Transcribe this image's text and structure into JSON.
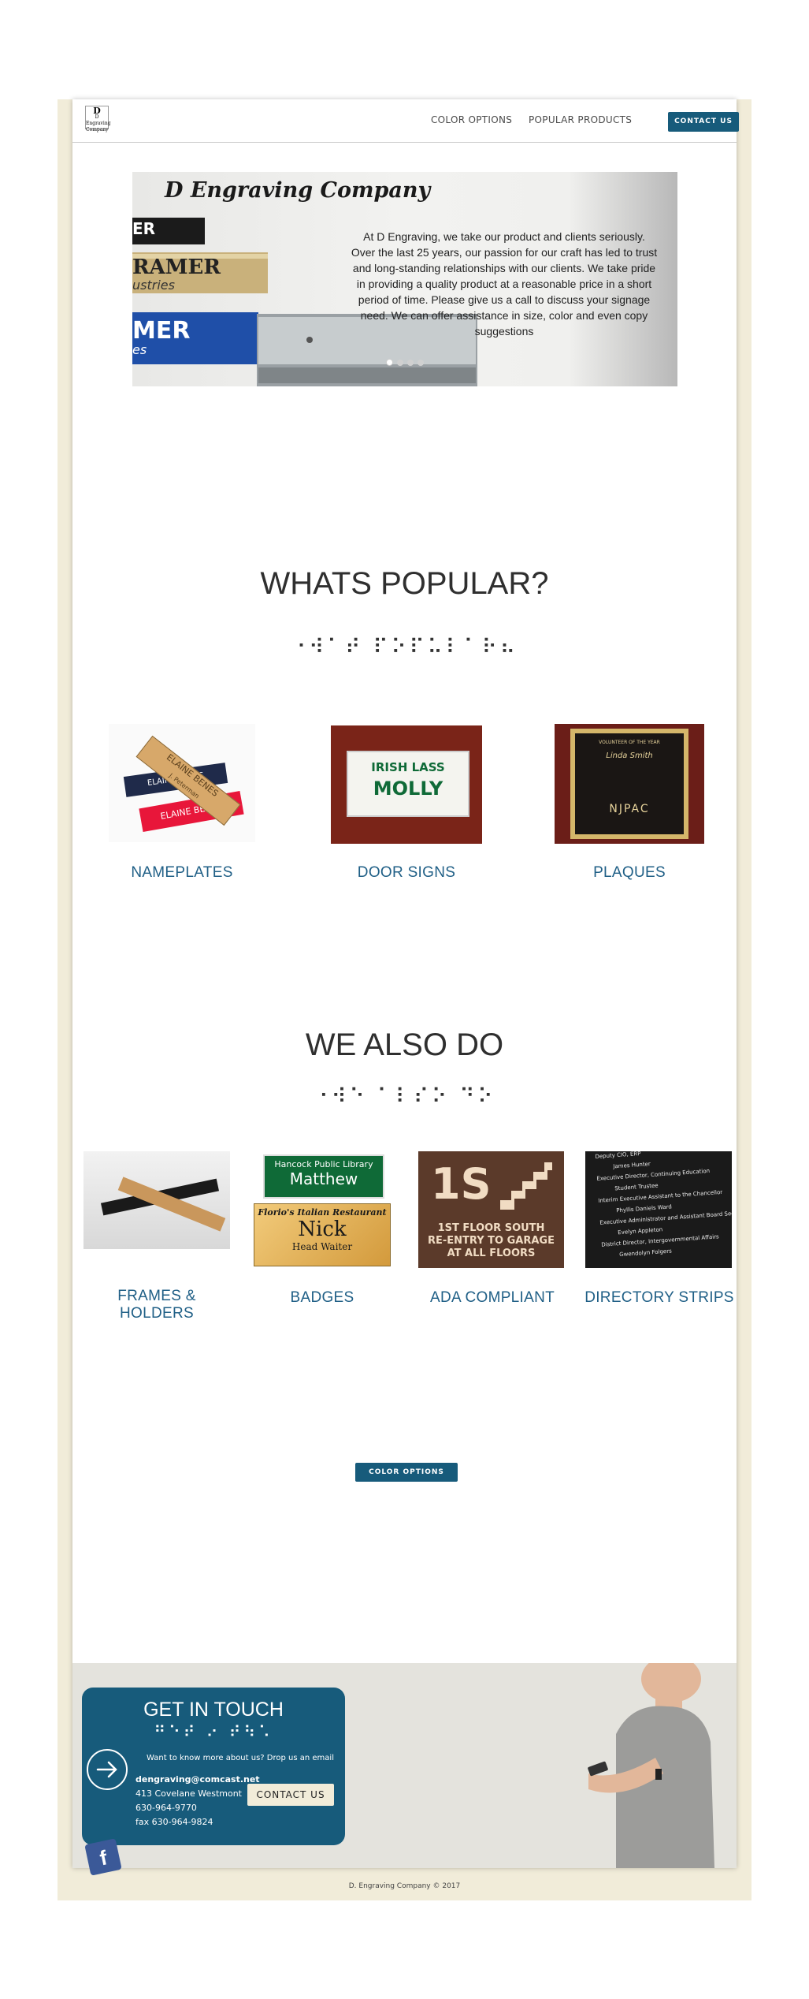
{
  "header": {
    "logo_text": "D Engraving Company",
    "nav": [
      "COLOR OPTIONS",
      "POPULAR PRODUCTS"
    ],
    "contact_button": "CONTACT US"
  },
  "hero": {
    "title": "D Engraving Company",
    "text": "At D Engraving, we take our product and clients seriously. Over the last 25 years, our passion for our craft has led to trust and long-standing relationships with our clients. We take pride in providing a quality product at a reasonable price in a short period of time. Please give us a call to discuss your signage need. We can offer assistance in size, color and even copy suggestions",
    "plates": [
      "ER",
      "RAMER",
      "MER"
    ],
    "plate_sub": [
      "ustries",
      "es"
    ]
  },
  "popular": {
    "heading": "WHATS POPULAR?",
    "braille": "⠐⠺⠁⠞ ⠏⠕⠏⠥⠇⠁⠗⠦",
    "items": [
      {
        "caption": "NAMEPLATES",
        "img_text": [
          "ELAINE BENES",
          "J. Peterman",
          "ELAINE BENES"
        ]
      },
      {
        "caption": "DOOR SIGNS",
        "img_text": [
          "IRISH LASS",
          "MOLLY"
        ]
      },
      {
        "caption": "PLAQUES",
        "img_text": [
          "VOLUNTEER OF THE YEAR",
          "Linda Smith",
          "NJPAC"
        ]
      }
    ]
  },
  "also": {
    "heading": "WE ALSO DO",
    "braille": "⠐⠺⠑ ⠁⠇⠎⠕ ⠙⠕",
    "items": [
      {
        "caption": "FRAMES & HOLDERS"
      },
      {
        "caption": "BADGES",
        "img_text": [
          "Hancock Public Library",
          "Matthew",
          "Florio's Italian Restaurant",
          "Nick",
          "Head Waiter"
        ]
      },
      {
        "caption": "ADA COMPLIANT",
        "img_text": [
          "1S",
          "1ST FLOOR SOUTH",
          "RE-ENTRY TO GARAGE",
          "AT ALL FLOORS"
        ]
      },
      {
        "caption": "DIRECTORY STRIPS",
        "img_text": [
          "Deputy CIO, ERP",
          "James Hunter",
          "Executive Director, Continuing Education",
          "Student Trustee",
          "Interim Executive Assistant to the Chancellor",
          "Phyllis Daniels Ward",
          "Executive Administrator and Assistant Board Secretary",
          "Evelyn Appleton",
          "District Director, Intergovernmental Affairs",
          "Gwendolyn Folgers"
        ]
      }
    ]
  },
  "color_options_button": "COLOR OPTIONS",
  "contact": {
    "title": "GET IN TOUCH",
    "braille": "⠛⠑⠞ ⠔ ⠞⠳⠡",
    "prompt": "Want to know more about us? Drop us an email",
    "email": "dengraving@comcast.net",
    "address": "413 Covelane Westmont",
    "phone": "630-964-9770",
    "fax": "fax 630-964-9824",
    "button": "CONTACT US"
  },
  "copyright": "D. Engraving Company © 2017",
  "colors": {
    "accent": "#175b7b",
    "frame": "#f1ecd9",
    "caption": "#1f5f86"
  },
  "icons": [
    "arrow-right-icon",
    "facebook-icon"
  ]
}
